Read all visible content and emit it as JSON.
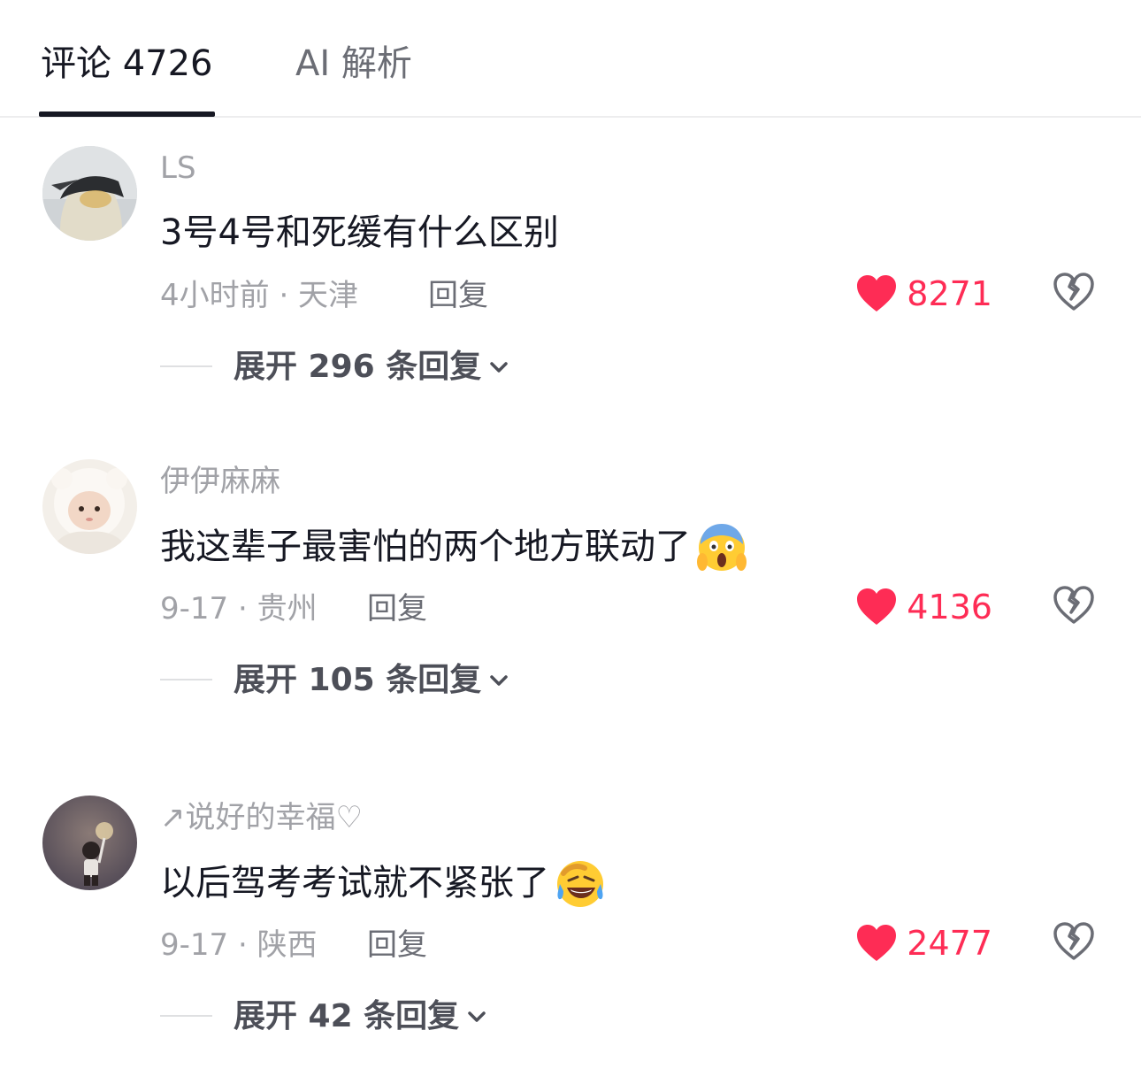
{
  "tabs": [
    {
      "label": "评论 4726",
      "active": true
    },
    {
      "label": "AI 解析",
      "active": false
    }
  ],
  "colors": {
    "accent": "#fe2c55",
    "text_primary": "#161823",
    "text_secondary": "#a1a2a7"
  },
  "comments": [
    {
      "username": "LS",
      "text": "3号4号和死缓有什么区别",
      "emoji": "",
      "meta": "4小时前 · 天津",
      "reply_label": "回复",
      "likes": "8271",
      "expand_label": "展开 296 条回复"
    },
    {
      "username": "伊伊麻麻",
      "text": "我这辈子最害怕的两个地方联动了",
      "emoji": "screaming-face-emoji",
      "meta": "9-17 · 贵州",
      "reply_label": "回复",
      "likes": "4136",
      "expand_label": "展开 105 条回复"
    },
    {
      "username": "↗说好的幸福♡",
      "text": "以后驾考考试就不紧张了",
      "emoji": "rolling-laughing-emoji",
      "meta": "9-17 · 陕西",
      "reply_label": "回复",
      "likes": "2477",
      "expand_label": "展开 42 条回复"
    }
  ]
}
